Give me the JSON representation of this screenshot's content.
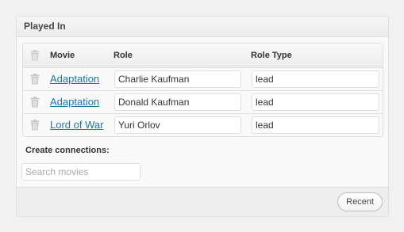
{
  "panel": {
    "title": "Played In"
  },
  "table": {
    "headers": {
      "movie": "Movie",
      "role": "Role",
      "role_type": "Role Type"
    },
    "rows": [
      {
        "movie": "Adaptation",
        "role": "Charlie Kaufman",
        "role_type": "lead"
      },
      {
        "movie": "Adaptation",
        "role": "Donald Kaufman",
        "role_type": "lead"
      },
      {
        "movie": "Lord of War",
        "role": "Yuri Orlov",
        "role_type": "lead"
      }
    ]
  },
  "create": {
    "label": "Create connections:",
    "search_placeholder": "Search movies"
  },
  "footer": {
    "recent_label": "Recent"
  },
  "icons": {
    "trash": "trash-icon"
  },
  "colors": {
    "link": "#21759b",
    "border": "#dfdfdf"
  }
}
